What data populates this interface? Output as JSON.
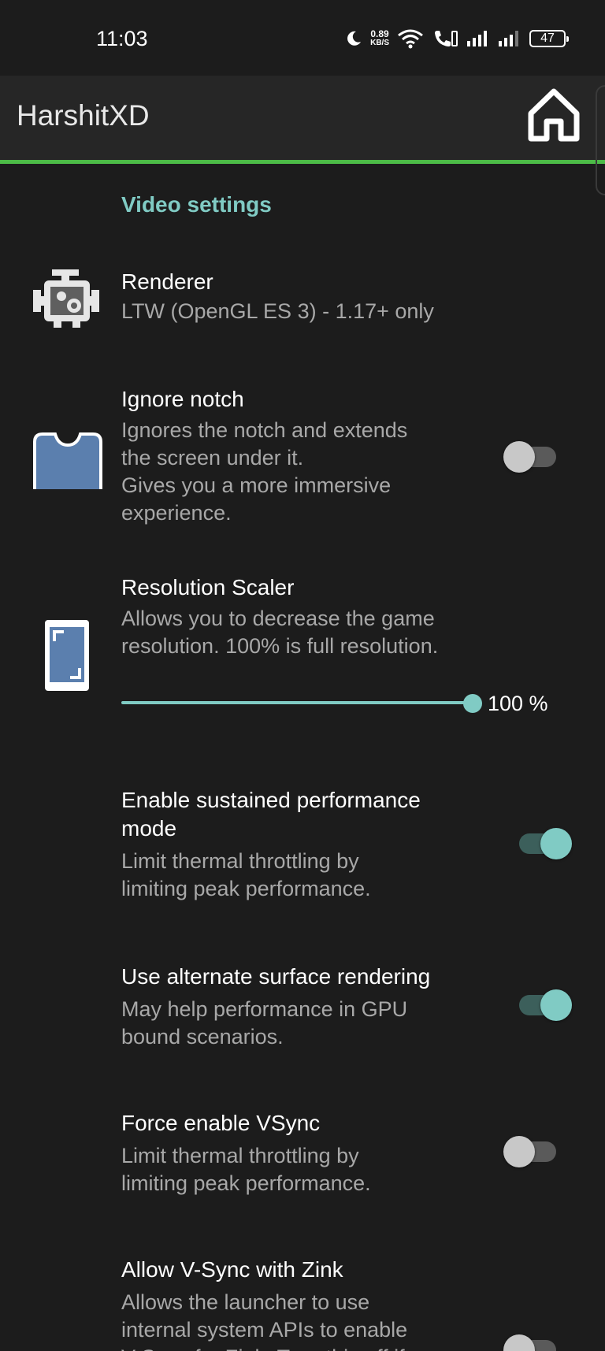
{
  "status_bar": {
    "time": "11:03",
    "net_speed_value": "0.89",
    "net_speed_unit": "KB/S",
    "battery": "47"
  },
  "app_bar": {
    "title": "HarshitXD",
    "accent_color": "#4cbb47"
  },
  "section": {
    "title": "Video settings",
    "accent_color": "#80cbc4"
  },
  "prefs": {
    "renderer": {
      "title": "Renderer",
      "summary": "LTW (OpenGL ES 3) - 1.17+ only",
      "icon": "engine-icon"
    },
    "ignore_notch": {
      "title": "Ignore notch",
      "summary_lines": [
        "Ignores the notch and extends",
        "the screen under it.",
        "Gives you a more immersive",
        "experience."
      ],
      "enabled": false,
      "icon": "notch-icon"
    },
    "resolution_scaler": {
      "title": "Resolution Scaler",
      "summary_lines": [
        "Allows you to decrease the game",
        "resolution. 100% is full resolution."
      ],
      "value_label": "100 %",
      "value_percent": 100,
      "icon": "resolution-icon"
    },
    "sustained_performance": {
      "title_lines": [
        "Enable sustained performance",
        "mode"
      ],
      "summary_lines": [
        "Limit thermal throttling by",
        "limiting peak performance."
      ],
      "enabled": true
    },
    "alternate_surface": {
      "title": "Use alternate surface rendering",
      "summary_lines": [
        "May help performance in GPU",
        "bound scenarios."
      ],
      "enabled": true
    },
    "force_vsync": {
      "title": "Force enable VSync",
      "summary_lines": [
        "Limit thermal throttling by",
        "limiting peak performance."
      ],
      "enabled": false
    },
    "vsync_zink": {
      "title": "Allow V-Sync with Zink",
      "summary_lines": [
        "Allows the launcher to use",
        "internal system APIs to enable",
        "V-Sync for Zink. Turn this off if"
      ],
      "enabled": false
    }
  }
}
